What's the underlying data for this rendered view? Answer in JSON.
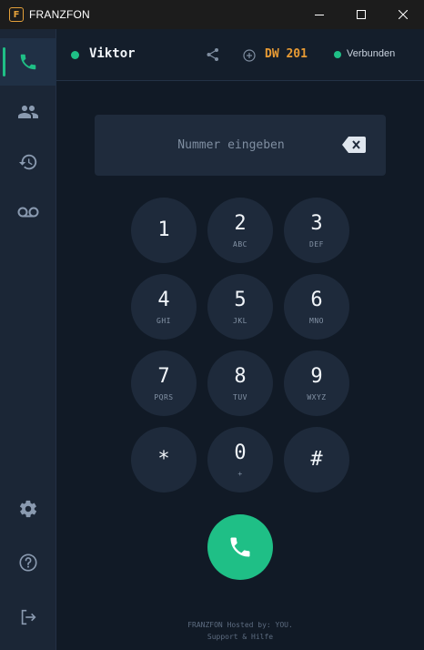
{
  "window": {
    "title": "FRANZFON",
    "logo_letter": "F"
  },
  "sidebar": {
    "items": [
      {
        "name": "phone",
        "active": true
      },
      {
        "name": "contacts",
        "active": false
      },
      {
        "name": "history",
        "active": false
      },
      {
        "name": "voicemail",
        "active": false
      },
      {
        "name": "settings",
        "active": false
      },
      {
        "name": "help",
        "active": false
      },
      {
        "name": "logout",
        "active": false
      }
    ]
  },
  "header": {
    "user": "Viktor",
    "extension": "DW 201",
    "status": "Verbunden"
  },
  "dialer": {
    "placeholder": "Nummer eingeben",
    "value": "",
    "keys": [
      {
        "digit": "1",
        "letters": ""
      },
      {
        "digit": "2",
        "letters": "ABC"
      },
      {
        "digit": "3",
        "letters": "DEF"
      },
      {
        "digit": "4",
        "letters": "GHI"
      },
      {
        "digit": "5",
        "letters": "JKL"
      },
      {
        "digit": "6",
        "letters": "MNO"
      },
      {
        "digit": "7",
        "letters": "PQRS"
      },
      {
        "digit": "8",
        "letters": "TUV"
      },
      {
        "digit": "9",
        "letters": "WXYZ"
      },
      {
        "digit": "*",
        "letters": ""
      },
      {
        "digit": "0",
        "letters": "+"
      },
      {
        "digit": "#",
        "letters": ""
      }
    ]
  },
  "footer": {
    "line1": "FRANZFON Hosted by: YOU.",
    "line2": "Support & Hilfe"
  },
  "colors": {
    "accent": "#1fbf86",
    "extension": "#e89b34",
    "background": "#111a26",
    "sidebar": "#1b2636"
  }
}
